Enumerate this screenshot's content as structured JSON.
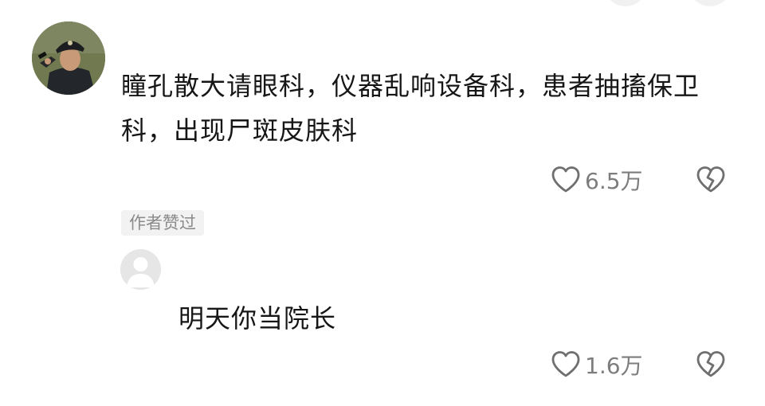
{
  "comment": {
    "avatar_icon": "user-avatar-photo",
    "text": "瞳孔散大请眼科，仪器乱响设备科，患者抽搐保卫科，出现尸斑皮肤科",
    "like_count": "6.5万",
    "like_icon": "heart-outline-icon",
    "dislike_icon": "broken-heart-icon"
  },
  "reply": {
    "badge": "作者赞过",
    "avatar_icon": "default-avatar-icon",
    "text": "明天你当院长",
    "like_count": "1.6万",
    "like_icon": "heart-outline-icon",
    "dislike_icon": "broken-heart-icon"
  },
  "colors": {
    "text": "#161616",
    "muted": "#7d7d7d",
    "badge_bg": "#f2f2f2",
    "icon_stroke": "#6f6f6f"
  }
}
